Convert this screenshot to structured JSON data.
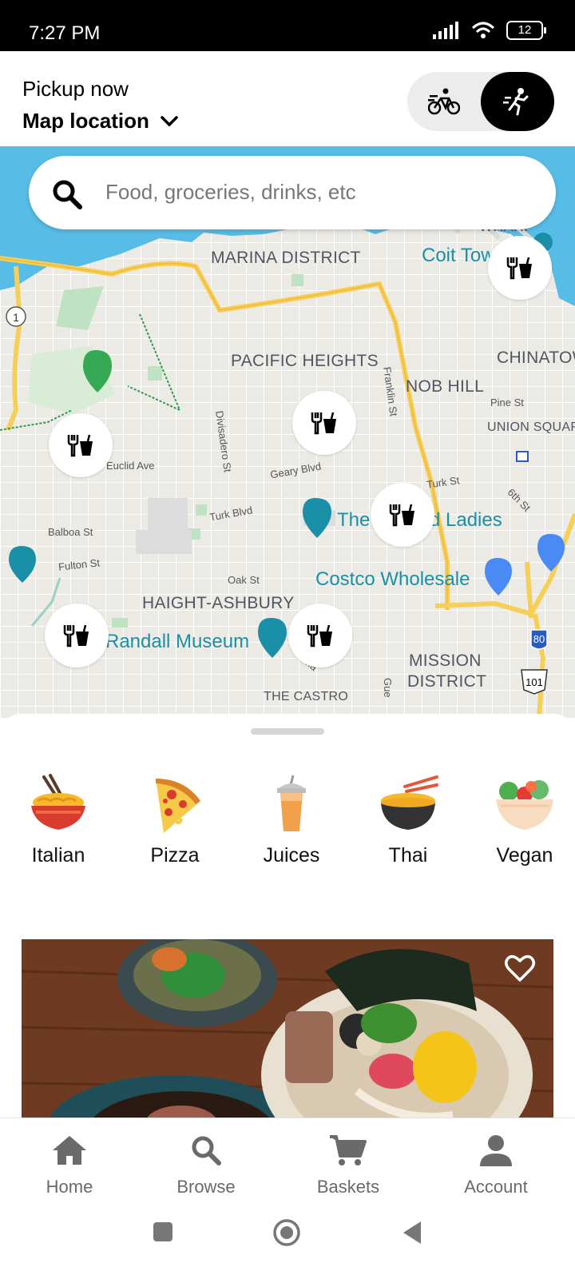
{
  "status_bar": {
    "time": "7:27 PM",
    "battery": "12"
  },
  "header": {
    "pickup_label": "Pickup now",
    "location": "Map location",
    "modes": [
      "bicycle-icon",
      "walking-person-icon"
    ],
    "active_mode": "pickup"
  },
  "search": {
    "placeholder": "Food, groceries, drinks, etc"
  },
  "map": {
    "labels": {
      "marina": "MARINA DISTRICT",
      "pacific": "PACIFIC HEIGHTS",
      "chinatown": "CHINATOW",
      "nob_hill": "NOB HILL",
      "union_square": "UNION SQUARE",
      "haight": "HAIGHT-ASHBURY",
      "mission": "MISSION",
      "mission2": "DISTRICT",
      "wharf": "WHARF",
      "castro": "THE CASTRO"
    },
    "poi": {
      "coit": "Coit Tow",
      "ladies_a": "The",
      "ladies_b": "d Ladies",
      "costco": "Costco Wholesale",
      "randall": "Randall Museum"
    },
    "streets": {
      "pine": "Pine St",
      "divisadero": "Divisadero St",
      "franklin": "Franklin St",
      "euclid": "Euclid Ave",
      "geary": "Geary Blvd",
      "turk_blvd": "Turk Blvd",
      "turk_st": "Turk St",
      "sixth": "6th St",
      "balboa": "Balboa St",
      "fulton": "Fulton St",
      "oak": "Oak St",
      "market": "Ma",
      "guerrero": "Gue"
    },
    "shields": {
      "route1": "1",
      "i80": "80",
      "us101": "101"
    }
  },
  "categories": [
    {
      "label": "Italian",
      "icon": "noodle-bowl-icon"
    },
    {
      "label": "Pizza",
      "icon": "pizza-icon"
    },
    {
      "label": "Juices",
      "icon": "juice-cup-icon"
    },
    {
      "label": "Thai",
      "icon": "ramen-bowl-icon"
    },
    {
      "label": "Vegan",
      "icon": "salad-bowl-icon"
    }
  ],
  "bottom_nav": [
    {
      "label": "Home",
      "icon": "home-icon"
    },
    {
      "label": "Browse",
      "icon": "search-icon"
    },
    {
      "label": "Baskets",
      "icon": "cart-icon"
    },
    {
      "label": "Account",
      "icon": "user-icon"
    }
  ],
  "colors": {
    "water": "#58bde6",
    "highway": "#f6cf58",
    "marker": "#ffffff",
    "nav_gray": "#6a6a6a",
    "poi": "#1a8fa8"
  }
}
